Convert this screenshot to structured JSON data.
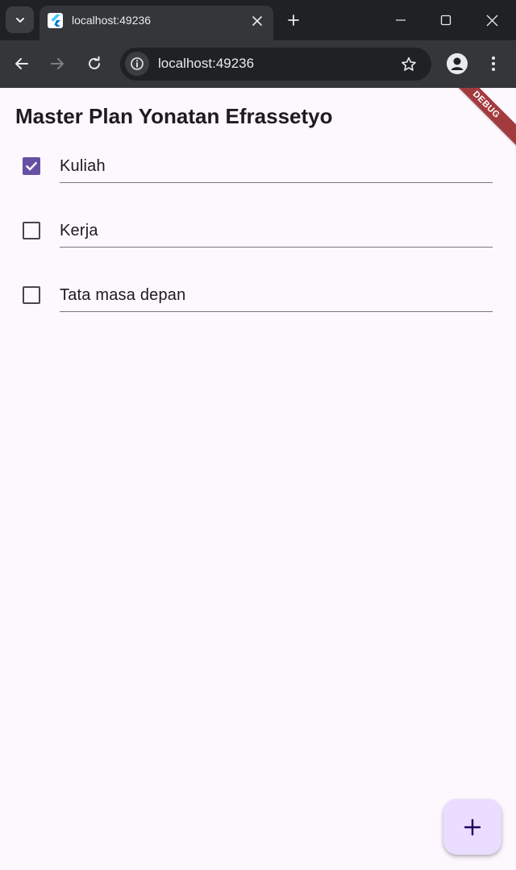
{
  "browser": {
    "tab_title": "localhost:49236",
    "url": "localhost:49236"
  },
  "app": {
    "title": "Master Plan Yonatan Efrassetyo",
    "debug_banner": "DEBUG",
    "accent_color": "#6750a4",
    "fab_color": "#eaddff",
    "tasks": [
      {
        "text": "Kuliah",
        "completed": true
      },
      {
        "text": "Kerja",
        "completed": false
      },
      {
        "text": "Tata masa depan",
        "completed": false
      }
    ],
    "fab_icon": "plus-icon"
  }
}
